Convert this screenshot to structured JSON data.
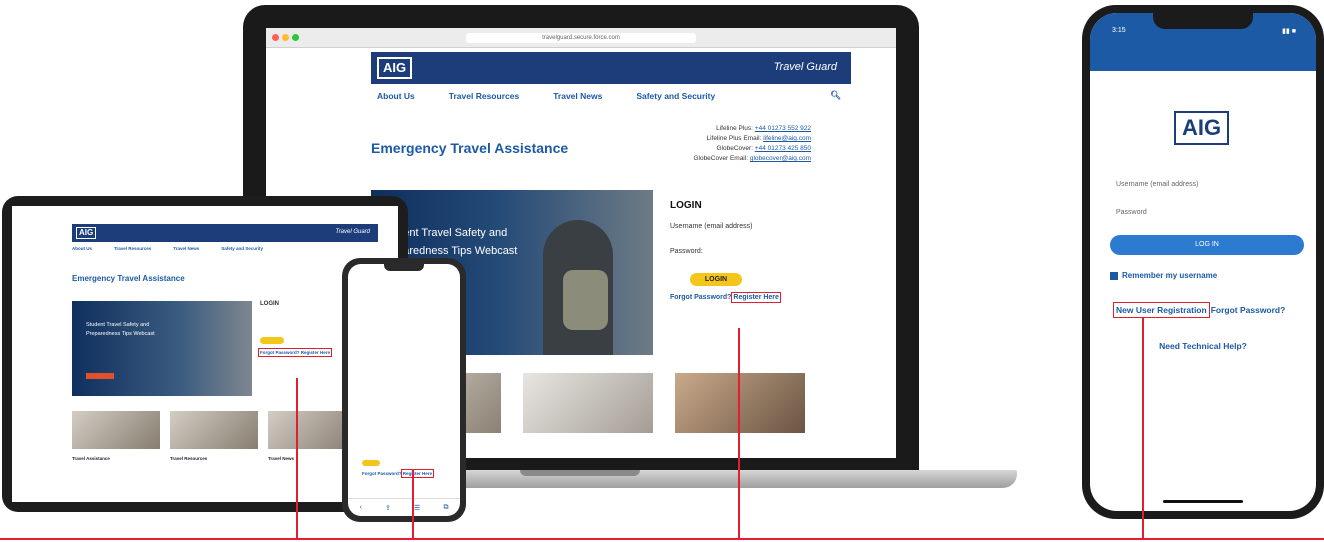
{
  "laptop": {
    "browser_url": "travelguard.secure.force.com",
    "brand": {
      "logo": "AIG",
      "product": "Travel Guard"
    },
    "nav": [
      "About Us",
      "Travel Resources",
      "Travel News",
      "Safety and Security"
    ],
    "page_title": "Emergency Travel Assistance",
    "contacts": [
      {
        "label": "Lifeline Plus:",
        "value": "+44 01273 552 922"
      },
      {
        "label": "Lifeline Plus Email:",
        "value": "lifeline@aig.com"
      },
      {
        "label": "GlobeCover:",
        "value": "+44 01273 425 850"
      },
      {
        "label": "GlobeCover Email:",
        "value": "globecover@aig.com"
      }
    ],
    "hero_text": [
      "udent Travel Safety and",
      "eparedness Tips Webcast"
    ],
    "login": {
      "heading": "LOGIN",
      "username_label": "Username (email address)",
      "password_label": "Password:",
      "button": "LOGIN",
      "forgot_password": "Forgot Password?",
      "register": "Register Here"
    }
  },
  "tablet": {
    "status_time": "",
    "brand": {
      "logo": "AIG",
      "product": "Travel Guard"
    },
    "nav": [
      "About Us",
      "Travel Resources",
      "Travel News",
      "Safety and Security"
    ],
    "page_title": "Emergency Travel Assistance",
    "hero_text": [
      "Student Travel Safety and",
      "Preparedness Tips Webcast"
    ],
    "login_heading": "LOGIN",
    "login_links": "Forgot Password? Register Here",
    "columns": [
      {
        "title": "Travel Assistance"
      },
      {
        "title": "Travel Resources"
      },
      {
        "title": "Travel News"
      }
    ]
  },
  "phone_small": {
    "login_links": [
      "Forgot Password?",
      "Register Here"
    ]
  },
  "phone_big": {
    "time": "3:15",
    "logo": "AIG",
    "username_placeholder": "Username (email address)",
    "password_placeholder": "Password",
    "login_button": "LOG IN",
    "remember_label": "Remember my username",
    "new_user": "New User Registration",
    "forgot_password": "Forgot Password?",
    "help": "Need Technical Help?"
  },
  "colors": {
    "brand_blue": "#1c3d7a",
    "link_blue": "#1c5aa6",
    "login_yellow": "#f4c51b",
    "highlight_red": "#e0202c"
  }
}
